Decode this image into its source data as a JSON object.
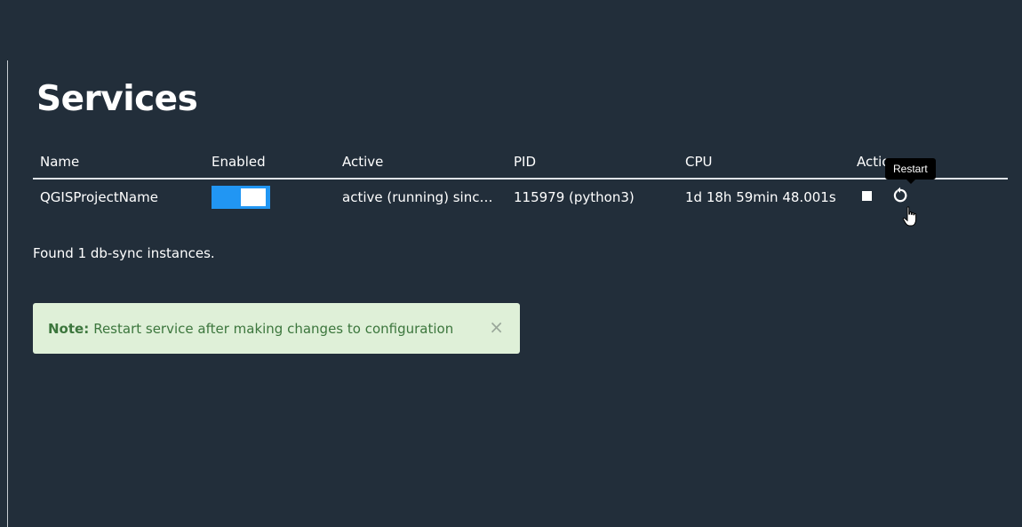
{
  "page": {
    "title": "Services"
  },
  "table": {
    "headers": [
      "Name",
      "Enabled",
      "Active",
      "PID",
      "CPU",
      "Actions"
    ],
    "rows": [
      {
        "name": "QGISProjectName",
        "enabled": true,
        "active": "active (running) since ...",
        "pid": "115979 (python3)",
        "cpu": "1d 18h 59min 48.001s"
      }
    ]
  },
  "tooltip": {
    "text": "Restart"
  },
  "summary": {
    "text": "Found 1 db-sync instances."
  },
  "alert": {
    "label": "Note:",
    "message": "Restart service after making changes to configuration",
    "close": "×"
  },
  "colors": {
    "background": "#222e3a",
    "toggle_on": "#2196f3",
    "alert_bg": "#dff0d8",
    "alert_text": "#3c763d"
  },
  "icons": [
    "stop-icon",
    "restart-icon",
    "close-icon",
    "hand-cursor-icon"
  ]
}
